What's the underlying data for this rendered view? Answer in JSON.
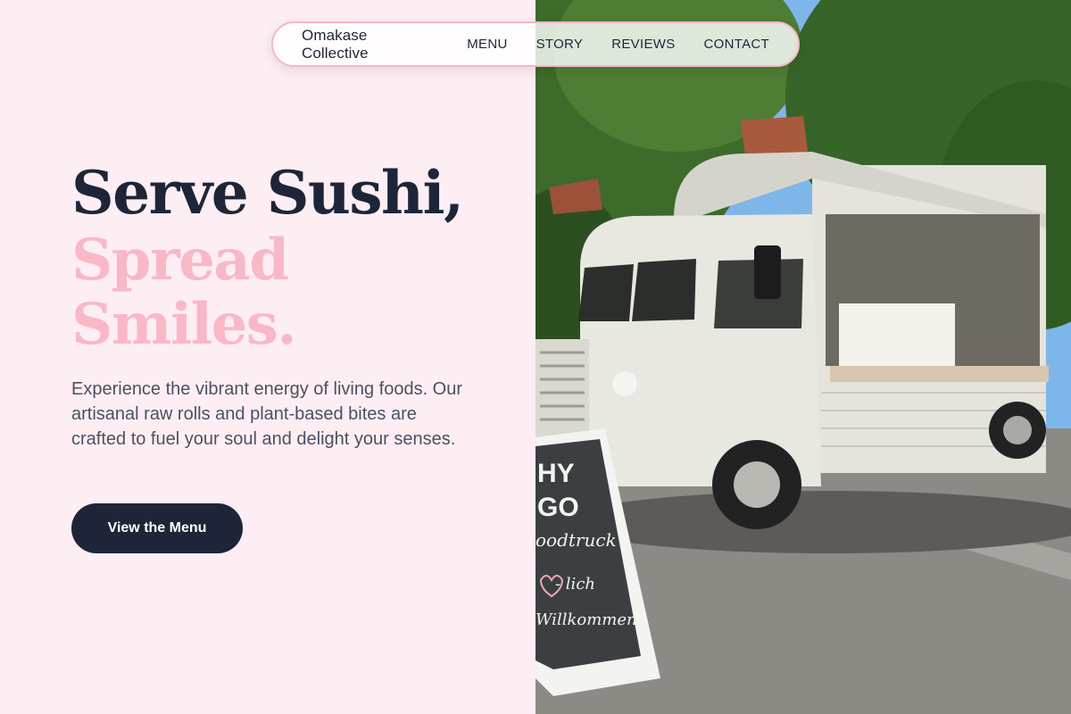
{
  "brand": "Omakase Collective",
  "nav": [
    "MENU",
    "STORY",
    "REVIEWS",
    "CONTACT"
  ],
  "hero": {
    "line1": "Serve Sushi,",
    "line2": "Spread",
    "line3": "Smiles.",
    "description": "Experience the vibrant energy of living foods. Our artisanal raw rolls and plant-based bites are crafted to fuel your soul and delight your senses.",
    "cta": "View the Menu"
  },
  "photo": {
    "sign_lines": [
      "HY",
      "GO",
      "oodtruck",
      "- lich",
      "Willkommen!"
    ]
  },
  "colors": {
    "background": "#fdeef3",
    "navy": "#1e2538",
    "pink": "#f8b8c8",
    "text": "#4a5162"
  }
}
